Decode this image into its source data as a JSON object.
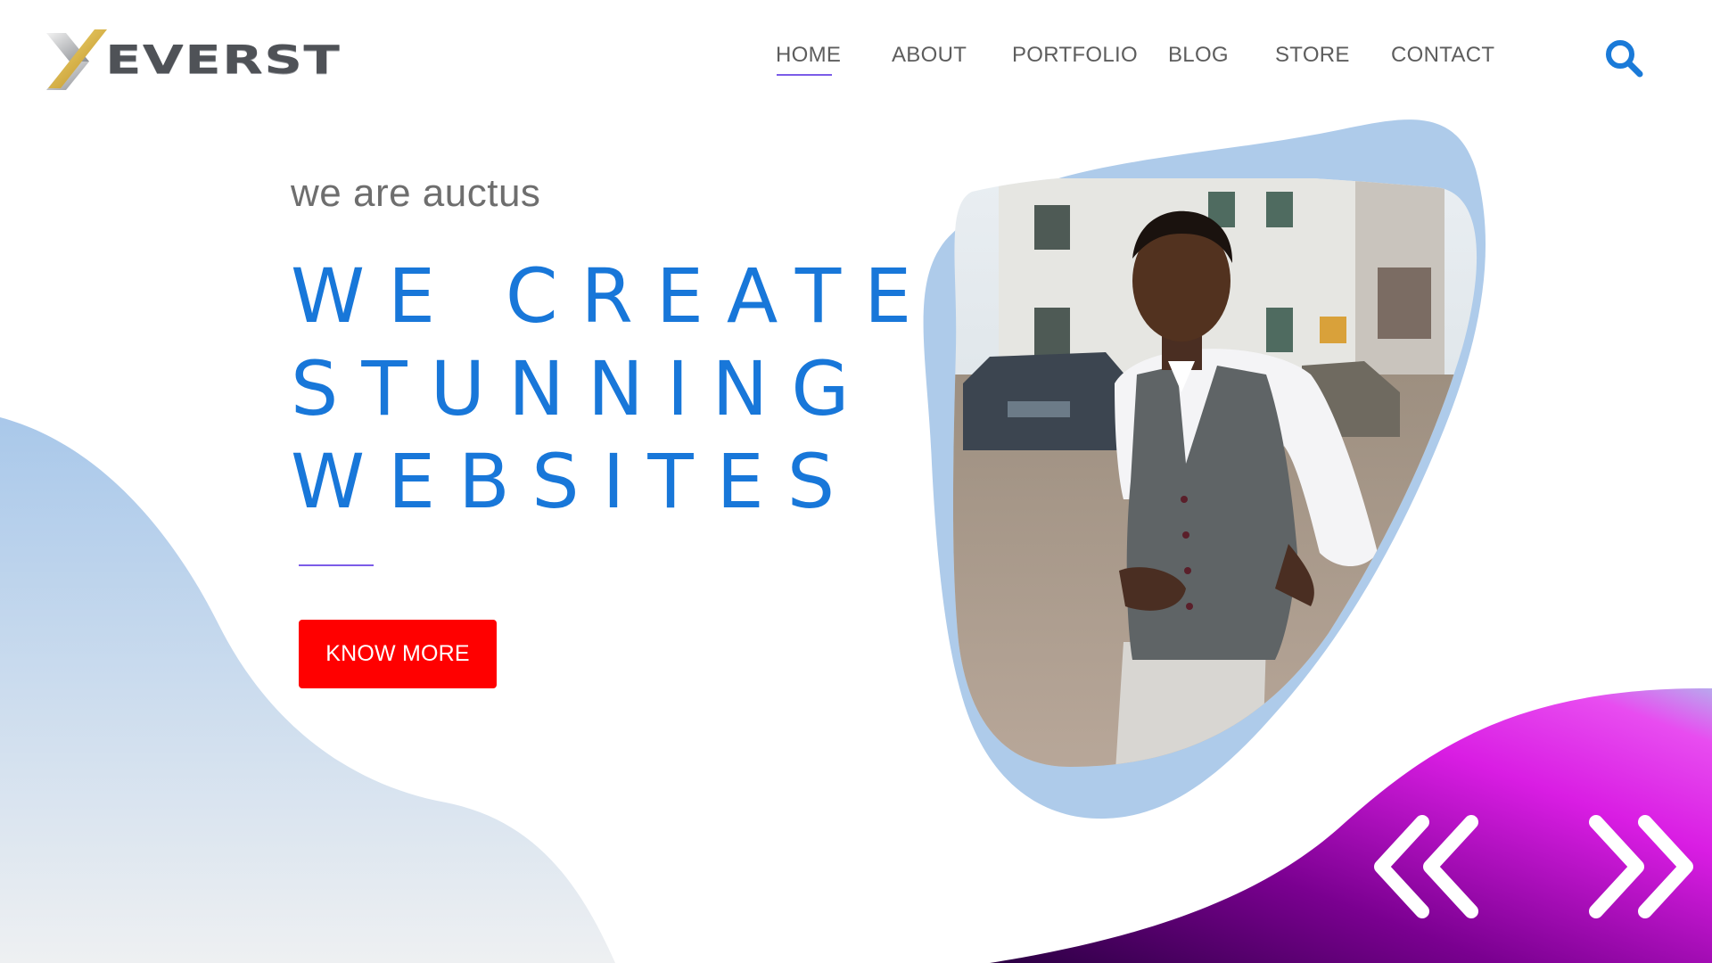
{
  "brand": {
    "name": "EVERST",
    "logo_icon": "x-chevron-logo-icon"
  },
  "nav": {
    "items": [
      {
        "label": "HOME",
        "active": true
      },
      {
        "label": "ABOUT",
        "active": false
      },
      {
        "label": "PORTFOLIO",
        "active": false
      },
      {
        "label": "BLOG",
        "active": false
      },
      {
        "label": "STORE",
        "active": false
      },
      {
        "label": "CONTACT",
        "active": false
      }
    ],
    "search_icon": "search-icon"
  },
  "hero": {
    "tagline": "we are auctus",
    "headline": [
      "WE CREATE",
      "STUNNING",
      "WEBSITES"
    ],
    "cta_label": "KNOW MORE",
    "photo_alt": "man in grey vest standing outdoors"
  },
  "slider": {
    "prev_icon": "double-chevron-left-icon",
    "next_icon": "double-chevron-right-icon"
  },
  "colors": {
    "accent_blue": "#1877d9",
    "cta_red": "#ff0000",
    "underline_purple": "#7b5ce8",
    "blob_blue": "#aecbea",
    "gradient_purple": "#a500c8",
    "gradient_magenta": "#e41ae8"
  }
}
